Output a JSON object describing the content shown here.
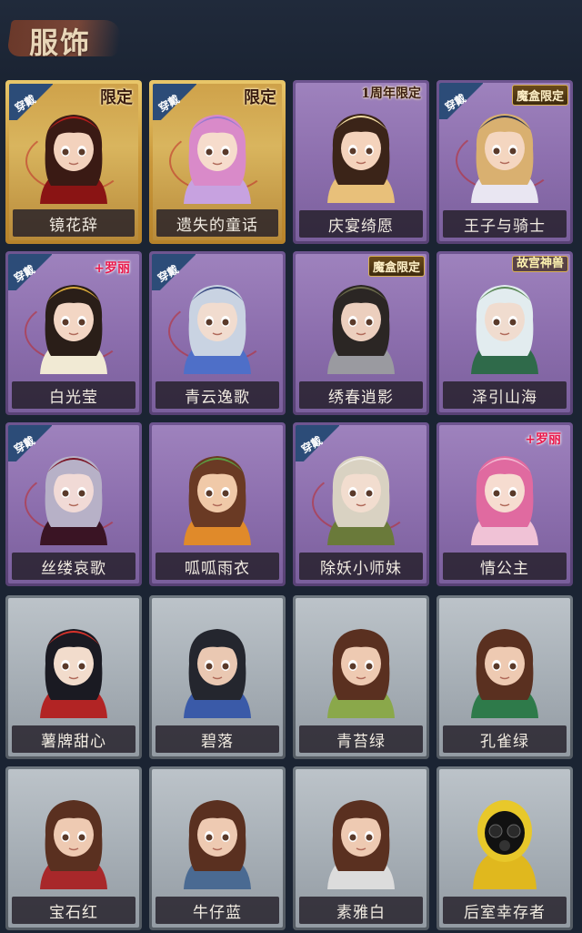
{
  "header": {
    "title": "服饰"
  },
  "worn_label": "穿戴",
  "colors": {
    "background": "#1b2433",
    "gold_frame": "#c9973a",
    "purple_frame": "#6e5590",
    "gray_frame": "#6f7880",
    "worn_badge": "#2c4c78",
    "lolita_tag": "#e8174a"
  },
  "cards": [
    {
      "name": "镜花辞",
      "rarity": "gold",
      "worn": true,
      "tag": "限定",
      "tag_style": "limited",
      "icon": "red-hood-character-icon"
    },
    {
      "name": "遗失的童话",
      "rarity": "gold",
      "worn": true,
      "tag": "限定",
      "tag_style": "limited",
      "icon": "pink-hair-character-icon"
    },
    {
      "name": "庆宴绮愿",
      "rarity": "purple",
      "worn": false,
      "tag": "1周年限定",
      "tag_style": "anniv",
      "icon": "cake-character-icon"
    },
    {
      "name": "王子与骑士",
      "rarity": "purple",
      "worn": true,
      "tag": "魔盒限定",
      "tag_style": "box",
      "icon": "prince-character-icon"
    },
    {
      "name": "白光莹",
      "rarity": "purple",
      "worn": true,
      "tag": "+罗丽",
      "tag_style": "lolita",
      "icon": "golden-crown-character-icon"
    },
    {
      "name": "青云逸歌",
      "rarity": "purple",
      "worn": true,
      "tag": "",
      "tag_style": "",
      "icon": "silver-hair-character-icon"
    },
    {
      "name": "绣春逍影",
      "rarity": "purple",
      "worn": false,
      "tag": "魔盒限定",
      "tag_style": "box",
      "icon": "swordsman-character-icon"
    },
    {
      "name": "泽引山海",
      "rarity": "purple",
      "worn": false,
      "tag": "故宫神兽",
      "tag_style": "palace",
      "icon": "white-hair-character-icon"
    },
    {
      "name": "丝缕哀歌",
      "rarity": "purple",
      "worn": true,
      "tag": "",
      "tag_style": "",
      "icon": "lace-headband-character-icon"
    },
    {
      "name": "呱呱雨衣",
      "rarity": "purple",
      "worn": false,
      "tag": "",
      "tag_style": "",
      "icon": "frog-hat-character-icon"
    },
    {
      "name": "除妖小师妹",
      "rarity": "purple",
      "worn": true,
      "tag": "",
      "tag_style": "",
      "icon": "blindfold-character-icon"
    },
    {
      "name": "情公主",
      "rarity": "purple",
      "worn": false,
      "tag": "+罗丽",
      "tag_style": "lolita",
      "icon": "pink-curls-character-icon"
    },
    {
      "name": "薯牌甜心",
      "rarity": "gray",
      "worn": false,
      "tag": "",
      "tag_style": "",
      "icon": "snake-hat-character-icon"
    },
    {
      "name": "碧落",
      "rarity": "gray",
      "worn": false,
      "tag": "",
      "tag_style": "",
      "icon": "braid-character-icon"
    },
    {
      "name": "青苔绿",
      "rarity": "gray",
      "worn": false,
      "tag": "",
      "tag_style": "",
      "icon": "green-dress-character-icon"
    },
    {
      "name": "孔雀绿",
      "rarity": "gray",
      "worn": false,
      "tag": "",
      "tag_style": "",
      "icon": "peacock-dress-character-icon"
    },
    {
      "name": "宝石红",
      "rarity": "gray",
      "worn": false,
      "tag": "",
      "tag_style": "",
      "icon": "red-dress-character-icon"
    },
    {
      "name": "牛仔蓝",
      "rarity": "gray",
      "worn": false,
      "tag": "",
      "tag_style": "",
      "icon": "denim-dress-character-icon"
    },
    {
      "name": "素雅白",
      "rarity": "gray",
      "worn": false,
      "tag": "",
      "tag_style": "",
      "icon": "white-dress-character-icon"
    },
    {
      "name": "后室幸存者",
      "rarity": "gray",
      "worn": false,
      "tag": "",
      "tag_style": "",
      "icon": "gas-mask-character-icon"
    }
  ]
}
